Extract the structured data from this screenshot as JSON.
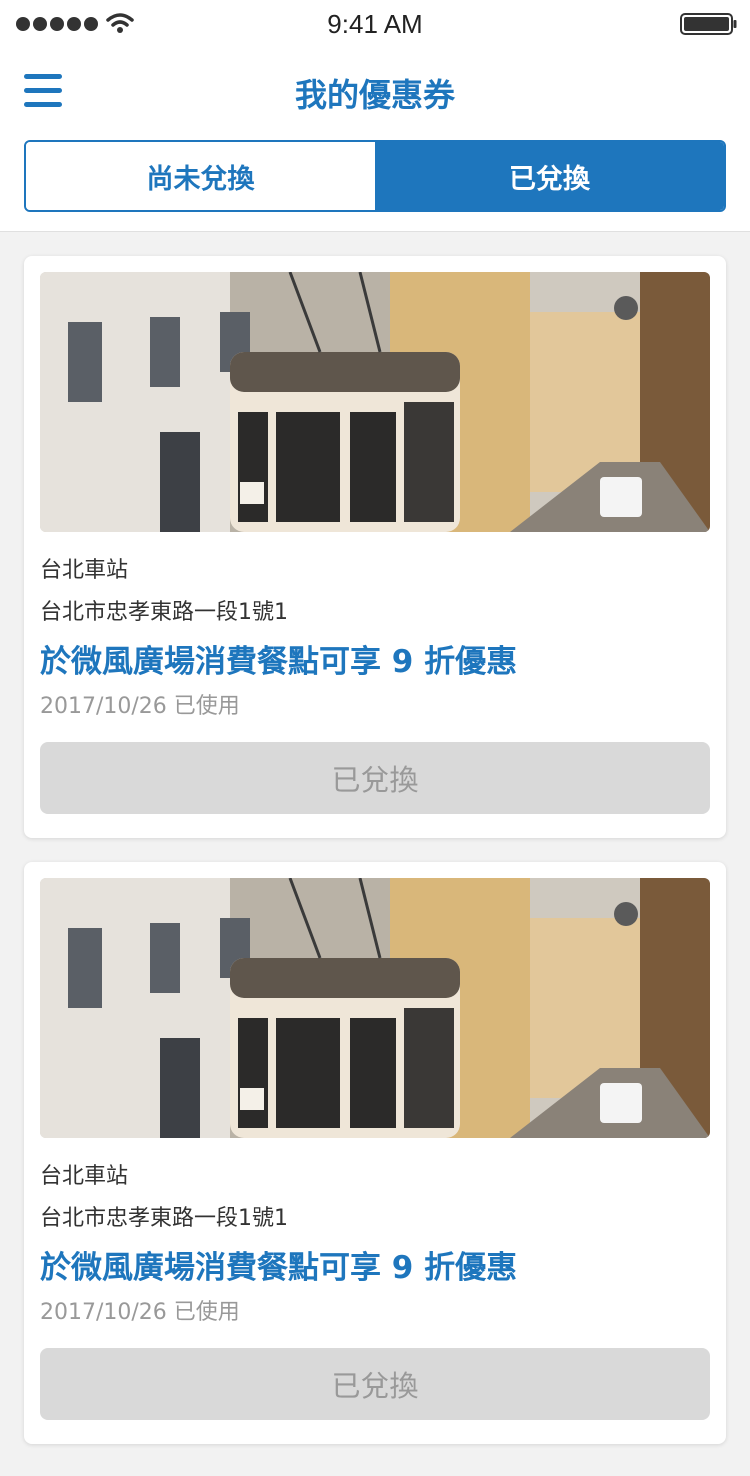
{
  "status_bar": {
    "time": "9:41 AM",
    "signal_icon": "signal-dots-icon",
    "wifi_icon": "wifi-icon",
    "battery_icon": "battery-icon"
  },
  "header": {
    "menu_icon": "hamburger-menu-icon",
    "title": "我的優惠券"
  },
  "tabs": [
    {
      "label": "尚未兌換",
      "active": false
    },
    {
      "label": "已兌換",
      "active": true
    }
  ],
  "colors": {
    "accent": "#1e76bd",
    "background": "#f2f2f2",
    "disabled_button": "#d9d9d9",
    "muted_text": "#999999"
  },
  "coupons": [
    {
      "image": "street-tram-photo",
      "store": "台北車站",
      "address": "台北市忠孝東路一段1號1",
      "offer": "於微風廣場消費餐點可享 9 折優惠",
      "used_info": "2017/10/26 已使用",
      "button_label": "已兌換"
    },
    {
      "image": "street-tram-photo",
      "store": "台北車站",
      "address": "台北市忠孝東路一段1號1",
      "offer": "於微風廣場消費餐點可享 9 折優惠",
      "used_info": "2017/10/26 已使用",
      "button_label": "已兌換"
    }
  ]
}
